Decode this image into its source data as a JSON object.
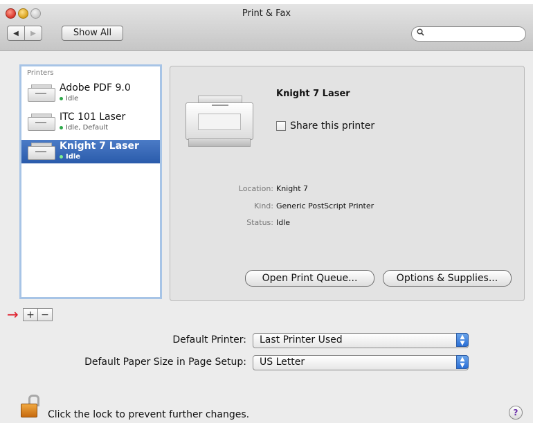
{
  "window": {
    "title": "Print & Fax"
  },
  "toolbar": {
    "back_glyph": "◀",
    "forward_glyph": "▶",
    "show_all_label": "Show All",
    "search_placeholder": "",
    "search_icon": "magnifier-icon"
  },
  "printers": {
    "header": "Printers",
    "items": [
      {
        "name": "Adobe PDF 9.0",
        "status": "Idle",
        "selected": false
      },
      {
        "name": "ITC 101 Laser",
        "status": "Idle, Default",
        "selected": false
      },
      {
        "name": "Knight 7 Laser",
        "status": "Idle",
        "selected": true
      }
    ],
    "add_label": "+",
    "remove_label": "−",
    "arrow_glyph": "→",
    "arrow_color": "#e01d2a"
  },
  "details": {
    "name": "Knight 7 Laser",
    "share_label": "Share this printer",
    "share_checked": false,
    "location_label": "Location:",
    "location_value": "Knight 7",
    "kind_label": "Kind:",
    "kind_value": "Generic PostScript Printer",
    "status_label": "Status:",
    "status_value": "Idle",
    "open_queue_label": "Open Print Queue...",
    "options_label": "Options & Supplies..."
  },
  "defaults": {
    "default_printer_label": "Default Printer:",
    "default_printer_value": "Last Printer Used",
    "paper_size_label": "Default Paper Size in Page Setup:",
    "paper_size_value": "US Letter"
  },
  "footer": {
    "lock_text": "Click the lock to prevent further changes.",
    "help_glyph": "?"
  },
  "colors": {
    "selection": "#2a5bab",
    "status_dot": "#2ea84a",
    "popup_stepper": "#2a6fd6"
  }
}
